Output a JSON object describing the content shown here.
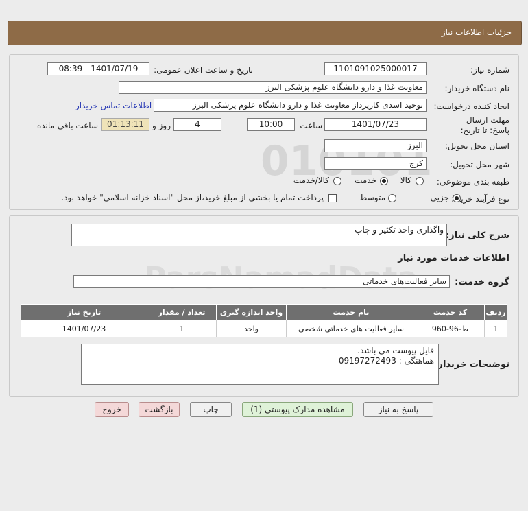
{
  "page_title": "جزئیات اطلاعات نیاز",
  "fields": {
    "need_number_label": "شماره نیاز:",
    "need_number": "1101091025000017",
    "announce_label": "تاریخ و ساعت اعلان عمومی:",
    "announce_value": "1401/07/19 - 08:39",
    "buyer_org_label": "نام دستگاه خریدار:",
    "buyer_org": "معاونت غذا و دارو دانشگاه علوم پزشکی البرز",
    "creator_label": "ایجاد کننده درخواست:",
    "creator": "توحید اسدی کارپرداز معاونت غذا و دارو دانشگاه علوم پزشکی البرز",
    "contact_link": "اطلاعات تماس خریدار",
    "deadline_label": "مهلت ارسال پاسخ: تا تاریخ:",
    "deadline_date": "1401/07/23",
    "time_label": "ساعت",
    "deadline_time": "10:00",
    "days_value": "4",
    "days_label": "روز و",
    "remaining_time": "01:13:11",
    "remaining_label": "ساعت باقی مانده",
    "province_label": "استان محل تحویل:",
    "province": "البرز",
    "city_label": "شهر محل تحویل:",
    "city": "کرج",
    "category_label": "طبقه بندی موضوعی:",
    "cat_goods": "کالا",
    "cat_service": "خدمت",
    "cat_goods_service": "کالا/خدمت",
    "process_label": "نوع فرآیند خرید :",
    "proc_partial": "جزیی",
    "proc_medium": "متوسط",
    "payment_note": "پرداخت تمام یا بخشی از مبلغ خرید،از محل \"اسناد خزانه اسلامی\" خواهد بود."
  },
  "summary": {
    "label": "شرح کلی نیاز:",
    "value": "واگذاری واحد تکثیر و چاپ",
    "services_heading": "اطلاعات خدمات مورد نیاز",
    "group_label": "گروه خدمت:",
    "group_value": "سایر فعالیت‌های خدماتی"
  },
  "table": {
    "headers": [
      "ردیف",
      "کد خدمت",
      "نام خدمت",
      "واحد اندازه گیری",
      "تعداد / مقدار",
      "تاریخ نیاز"
    ],
    "rows": [
      [
        "1",
        "ط-96-960",
        "سایر فعالیت های خدماتی شخصی",
        "واحد",
        "1",
        "1401/07/23"
      ]
    ]
  },
  "notes": {
    "label": "توضیحات خریدار:",
    "line1": "فایل پیوست می باشد.",
    "line2": "هماهنگی : 09197272493"
  },
  "buttons": {
    "reply": "پاسخ به نیاز",
    "docs": "مشاهده مدارک پیوستی (1)",
    "print": "چاپ",
    "back": "بازگشت",
    "exit": "خروج"
  },
  "watermark": {
    "brand": "ParsNamadData",
    "phone": "۰۲۱-۸۸۳۴۹۶۷۰"
  }
}
